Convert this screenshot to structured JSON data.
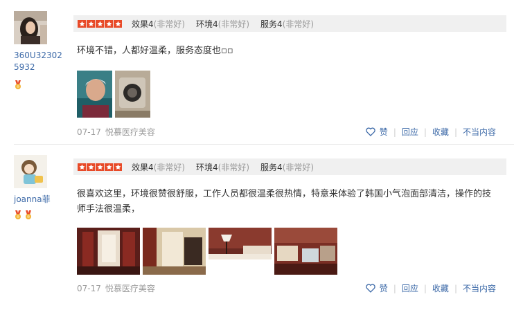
{
  "colors": {
    "accent_blue": "#3d6aa8",
    "star_red": "#e84a28",
    "muted": "#999999",
    "bar_bg": "#f0f0f0"
  },
  "reviews": [
    {
      "user": "360U323025932",
      "medal_count": 1,
      "stars": 5,
      "scores": [
        {
          "label": "效果4",
          "desc": "(非常好)"
        },
        {
          "label": "环境4",
          "desc": "(非常好)"
        },
        {
          "label": "服务4",
          "desc": "(非常好)"
        }
      ],
      "content": "环境不错，人都好温柔，服务态度也▫▫",
      "photo_count": 2,
      "date": "07-17",
      "shop": "悦慕医疗美容",
      "actions": {
        "like": "赞",
        "reply": "回应",
        "favorite": "收藏",
        "report": "不当内容"
      }
    },
    {
      "user": "joanna菲",
      "medal_count": 2,
      "stars": 5,
      "scores": [
        {
          "label": "效果4",
          "desc": "(非常好)"
        },
        {
          "label": "环境4",
          "desc": "(非常好)"
        },
        {
          "label": "服务4",
          "desc": "(非常好)"
        }
      ],
      "content": "很喜欢这里，环境很赞很舒服，工作人员都很温柔很热情，特意来体验了韩国小气泡面部清洁，操作的技师手法很温柔，",
      "photo_count": 4,
      "date": "07-17",
      "shop": "悦慕医疗美容",
      "actions": {
        "like": "赞",
        "reply": "回应",
        "favorite": "收藏",
        "report": "不当内容"
      }
    }
  ]
}
